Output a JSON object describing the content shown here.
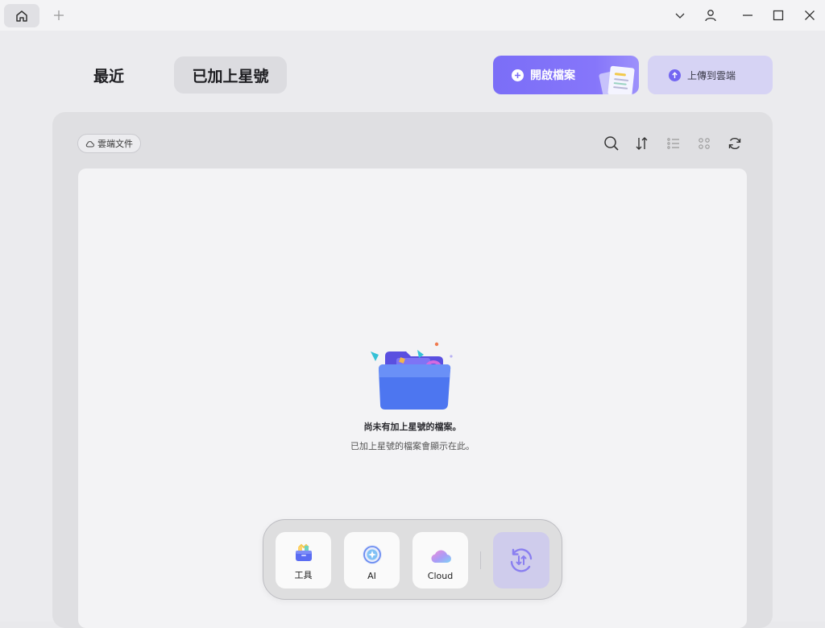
{
  "titlebar": {
    "home_icon": "home-icon",
    "new_tab_icon": "plus-icon",
    "controls": [
      "chevron-down-icon",
      "user-icon",
      "minimize-icon",
      "maximize-icon",
      "close-icon"
    ]
  },
  "tabs": {
    "recent": "最近",
    "starred": "已加上星號"
  },
  "actions": {
    "open_file": "開啟檔案",
    "upload_cloud": "上傳到雲端"
  },
  "toolbar": {
    "cloud_docs": "雲端文件",
    "icons": [
      "search-icon",
      "sort-icon",
      "list-view-icon",
      "grid-view-icon",
      "refresh-icon"
    ]
  },
  "empty_state": {
    "title": "尚未有加上星號的檔案。",
    "subtitle": "已加上星號的檔案會顯示在此。"
  },
  "dock": {
    "tools": "工具",
    "ai": "AI",
    "cloud": "Cloud"
  },
  "colors": {
    "accent": "#7b6ef7",
    "accent_light": "#d6d3f4"
  }
}
